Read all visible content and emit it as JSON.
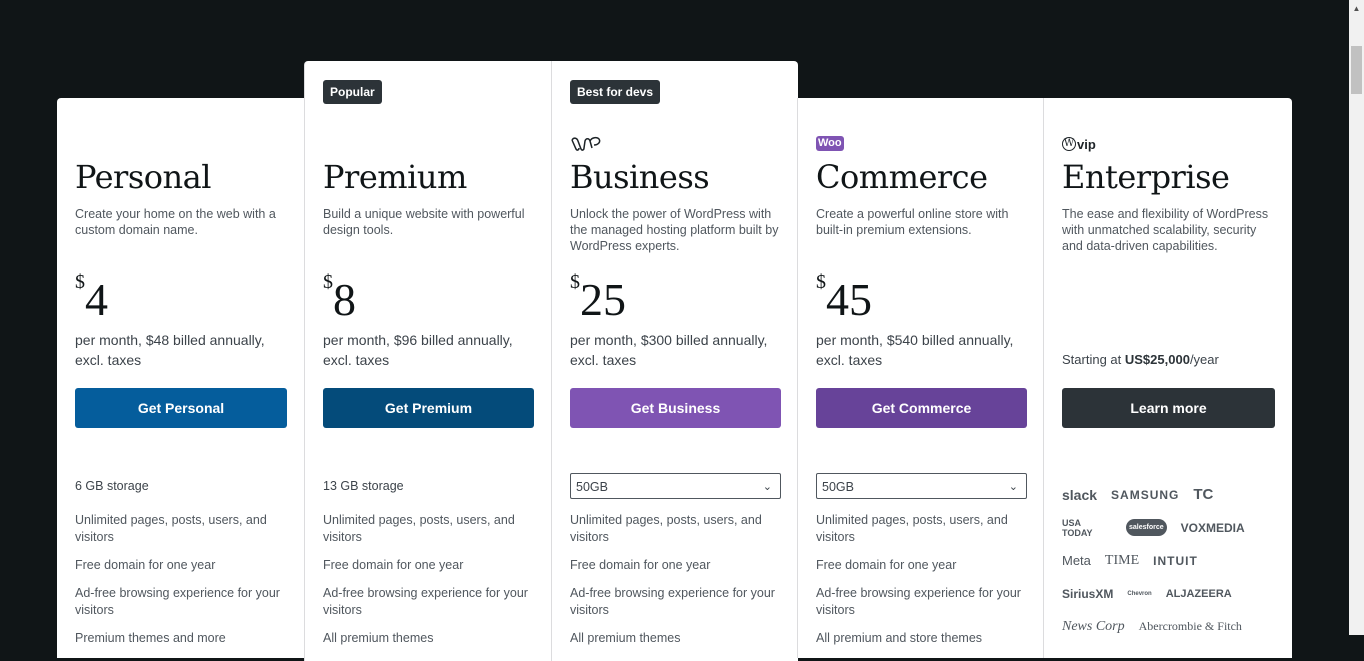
{
  "plans": [
    {
      "name": "Personal",
      "badge": null,
      "description": "Create your home on the web with a custom domain name.",
      "currency": "$",
      "price": "4",
      "billing": "per month, $48 billed annually, excl. taxes",
      "button_label": "Get Personal",
      "button_color": "#055d9c",
      "storage": "6 GB storage",
      "features": [
        "Unlimited pages, posts, users, and visitors",
        "Free domain for one year",
        "Ad-free browsing experience for your visitors",
        "Premium themes and more"
      ]
    },
    {
      "name": "Premium",
      "badge": "Popular",
      "description": "Build a unique website with powerful design tools.",
      "currency": "$",
      "price": "8",
      "billing": "per month, $96 billed annually, excl. taxes",
      "button_label": "Get Premium",
      "button_color": "#044b7a",
      "storage": "13 GB storage",
      "features": [
        "Unlimited pages, posts, users, and visitors",
        "Free domain for one year",
        "Ad-free browsing experience for your visitors",
        "All premium themes"
      ]
    },
    {
      "name": "Business",
      "badge": "Best for devs",
      "logo": "wp-cloud-icon",
      "description": "Unlock the power of WordPress with the managed hosting platform built by WordPress experts.",
      "currency": "$",
      "price": "25",
      "billing": "per month, $300 billed annually, excl. taxes",
      "button_label": "Get Business",
      "button_color": "#7f54b3",
      "storage_select": "50GB",
      "features": [
        "Unlimited pages, posts, users, and visitors",
        "Free domain for one year",
        "Ad-free browsing experience for your visitors",
        "All premium themes"
      ]
    },
    {
      "name": "Commerce",
      "badge": null,
      "logo": "woo-icon",
      "description": "Create a powerful online store with built-in premium extensions.",
      "currency": "$",
      "price": "45",
      "billing": "per month, $540 billed annually, excl. taxes",
      "button_label": "Get Commerce",
      "button_color": "#674399",
      "storage_select": "50GB",
      "features": [
        "Unlimited pages, posts, users, and visitors",
        "Free domain for one year",
        "Ad-free browsing experience for your visitors",
        "All premium and store themes"
      ]
    },
    {
      "name": "Enterprise",
      "badge": null,
      "logo": "wpvip-icon",
      "logo_text": "vip",
      "description": "The ease and flexibility of WordPress with unmatched scalability, security and data-driven capabilities.",
      "starting_prefix": "Starting at ",
      "starting_price": "US$25,000",
      "starting_suffix": "/year",
      "button_label": "Learn more",
      "button_color": "#2c3338",
      "client_logos": [
        [
          "slack",
          "SAMSUNG",
          "TC"
        ],
        [
          "USA TODAY",
          "salesforce",
          "VOXMEDIA"
        ],
        [
          "Meta",
          "TIME",
          "INTUIT"
        ],
        [
          "SiriusXM",
          "Chevron",
          "ALJAZEERA"
        ],
        [
          "News Corp",
          "Abercrombie & Fitch"
        ]
      ]
    }
  ]
}
